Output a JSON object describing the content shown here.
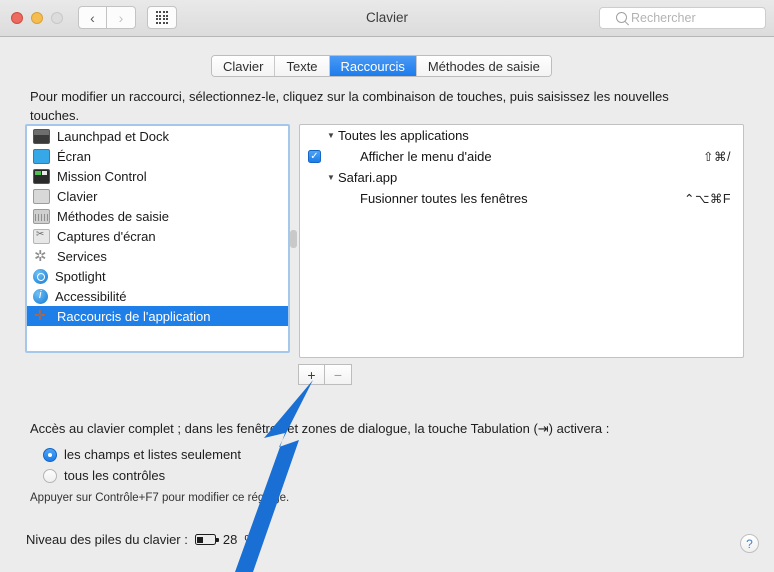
{
  "window": {
    "title": "Clavier",
    "traffic_lights": [
      "close",
      "minimize",
      "zoom"
    ],
    "nav_back": "‹",
    "nav_forward": "›",
    "grid_button": "show-all-icon"
  },
  "search": {
    "placeholder": "Rechercher",
    "value": "",
    "icon": "search-icon"
  },
  "tabs": [
    {
      "label": "Clavier",
      "active": false
    },
    {
      "label": "Texte",
      "active": false
    },
    {
      "label": "Raccourcis",
      "active": true
    },
    {
      "label": "Méthodes de saisie",
      "active": false
    }
  ],
  "description": "Pour modifier un raccourci, sélectionnez-le, cliquez sur la combinaison de touches, puis saisissez les nouvelles touches.",
  "categories": [
    {
      "label": "Launchpad et Dock",
      "icon": "launchpad-icon",
      "selected": false
    },
    {
      "label": "Écran",
      "icon": "display-icon",
      "selected": false
    },
    {
      "label": "Mission Control",
      "icon": "mission-control-icon",
      "selected": false
    },
    {
      "label": "Clavier",
      "icon": "keyboard-icon",
      "selected": false
    },
    {
      "label": "Méthodes de saisie",
      "icon": "input-methods-icon",
      "selected": false
    },
    {
      "label": "Captures d'écran",
      "icon": "screenshot-icon",
      "selected": false
    },
    {
      "label": "Services",
      "icon": "gear-icon",
      "selected": false
    },
    {
      "label": "Spotlight",
      "icon": "spotlight-icon",
      "selected": false
    },
    {
      "label": "Accessibilité",
      "icon": "accessibility-icon",
      "selected": false
    },
    {
      "label": "Raccourcis de l'application",
      "icon": "app-shortcuts-icon",
      "selected": true
    }
  ],
  "shortcuts_tree": [
    {
      "type": "group",
      "disclosure": "▼",
      "label": "Toutes les applications"
    },
    {
      "type": "item",
      "checked": true,
      "check_glyph": "✓",
      "label": "Afficher le menu d'aide",
      "keys": "⇧⌘/"
    },
    {
      "type": "group",
      "disclosure": "▼",
      "label": "Safari.app"
    },
    {
      "type": "item",
      "checked": false,
      "label": "Fusionner toutes les fenêtres",
      "keys": "⌃⌥⌘F"
    }
  ],
  "list_buttons": {
    "add_label": "+",
    "remove_label": "−"
  },
  "full_keyboard_access": {
    "description": "Accès au clavier complet ; dans les fenêtres et zones de dialogue, la touche Tabulation (⇥) activera :",
    "options": [
      {
        "label": "les champs et listes seulement",
        "selected": true
      },
      {
        "label": "tous les contrôles",
        "selected": false
      }
    ],
    "hint": "Appuyer sur Contrôle+F7 pour modifier ce réglage."
  },
  "battery": {
    "label": "Niveau des piles du clavier :",
    "value": "28",
    "unit": "%",
    "icon": "battery-icon",
    "percent": 28
  },
  "help_button": {
    "label": "?",
    "icon": "question-mark-icon"
  },
  "annotation": {
    "type": "arrow",
    "color": "#1a6fd4",
    "points_to": "add-shortcut-button"
  },
  "colors": {
    "accent": "#1e7fe8",
    "window_bg": "#ececec",
    "panel_bg": "#ffffff",
    "arrow": "#1a6fd4"
  }
}
